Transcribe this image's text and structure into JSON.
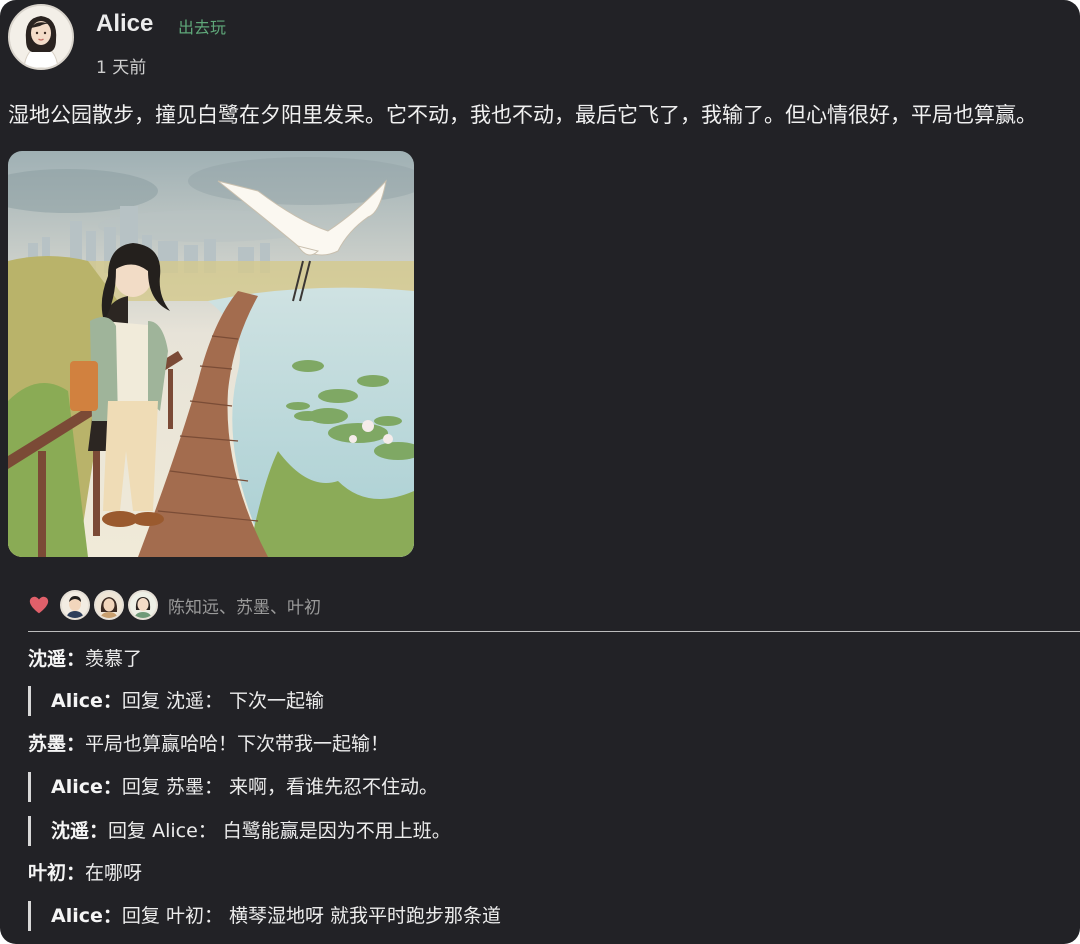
{
  "post": {
    "author": "Alice",
    "tag": "出去玩",
    "time": "1 天前",
    "text": "湿地公园散步，撞见白鹭在夕阳里发呆。它不动，我也不动，最后它飞了，我输了。但心情很好，平局也算赢。",
    "image_icon": "wetland-illustration",
    "colors": {
      "background": "#222226",
      "tag": "#5fa779",
      "heart": "#e0606a"
    }
  },
  "likes": {
    "icon": "heart-icon",
    "names": "陈知远、苏墨、叶初"
  },
  "comments": [
    {
      "author": "沈遥",
      "sep": "：",
      "text": "羡慕了"
    },
    {
      "author": "Alice",
      "sep": "：",
      "prefix": "回复 沈遥：",
      "text": " 下次一起输"
    },
    {
      "author": "苏墨",
      "sep": "：",
      "text": "平局也算赢哈哈！下次带我一起输！"
    },
    {
      "author": "Alice",
      "sep": "：",
      "prefix": "回复 苏墨：",
      "text": " 来啊，看谁先忍不住动。"
    },
    {
      "author": "沈遥",
      "sep": "：",
      "prefix": "回复 Alice：",
      "text": " 白鹭能赢是因为不用上班。"
    },
    {
      "author": "叶初",
      "sep": "：",
      "text": "在哪呀"
    },
    {
      "author": "Alice",
      "sep": "：",
      "prefix": "回复 叶初：",
      "text": " 横琴湿地呀 就我平时跑步那条道"
    }
  ]
}
